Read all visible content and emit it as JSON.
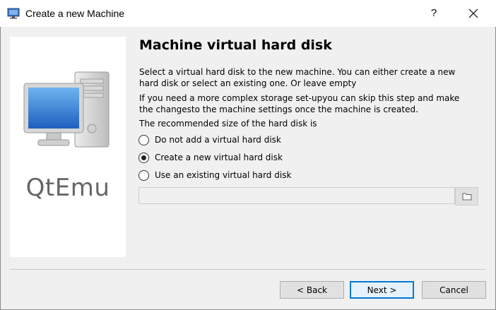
{
  "window": {
    "title": "Create a new Machine",
    "help_label": "?",
    "app_icon": "computer-icon",
    "close_icon": "close-icon"
  },
  "side_panel": {
    "brand": "QtEmu",
    "illustration": "desktop-computer-icon"
  },
  "page": {
    "title": "Machine virtual hard disk",
    "description_1": "Select a virtual hard disk to the new machine. You can either create a new hard disk or select an existing one. Or leave empty",
    "description_2": "If you need a more complex storage set-upyou can skip this step and make the changesto the machine settings once the machine is created.",
    "description_3": "The recommended size of the hard disk is",
    "options": [
      {
        "label": "Do not add a virtual hard disk",
        "checked": false
      },
      {
        "label": "Create a new virtual hard disk",
        "checked": true
      },
      {
        "label": "Use an existing virtual hard disk",
        "checked": false
      }
    ],
    "path_value": "",
    "browse_icon": "folder-icon"
  },
  "buttons": {
    "back": "< Back",
    "next": "Next >",
    "cancel": "Cancel"
  },
  "colors": {
    "accent": "#0078d7",
    "panel": "#ffffff",
    "dialog_bg": "#f0f0f0",
    "brand_text": "#666666"
  }
}
